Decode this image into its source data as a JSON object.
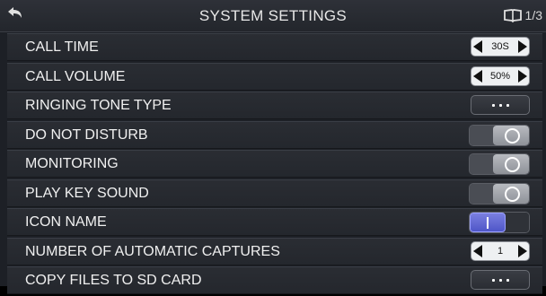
{
  "header": {
    "title": "SYSTEM SETTINGS",
    "page_indicator": "1/3",
    "back_icon": "back-arrow-icon",
    "page_icon": "book-icon"
  },
  "rows": [
    {
      "label": "CALL TIME",
      "control": "stepper",
      "value": "30S"
    },
    {
      "label": "CALL VOLUME",
      "control": "stepper",
      "value": "50%"
    },
    {
      "label": "RINGING TONE TYPE",
      "control": "more",
      "value": "• • •"
    },
    {
      "label": "DO NOT DISTURB",
      "control": "toggle",
      "state": "off"
    },
    {
      "label": "MONITORING",
      "control": "toggle",
      "state": "off"
    },
    {
      "label": "PLAY KEY SOUND",
      "control": "toggle",
      "state": "off"
    },
    {
      "label": "ICON NAME",
      "control": "toggle",
      "state": "on"
    },
    {
      "label": "NUMBER OF AUTOMATIC CAPTURES",
      "control": "stepper",
      "value": "1"
    },
    {
      "label": "COPY FILES TO SD CARD",
      "control": "more",
      "value": "• • •"
    }
  ],
  "colors": {
    "background": "#1d2026",
    "toggle_on": "#5a60d8",
    "text": "#f0f0f0"
  }
}
